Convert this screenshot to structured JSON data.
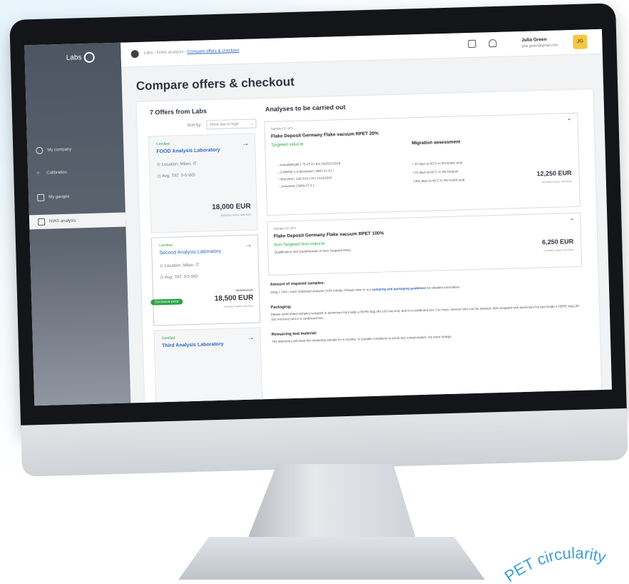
{
  "app": {
    "logo": "Labs"
  },
  "sidebar": {
    "items": [
      {
        "label": "My company",
        "active": false
      },
      {
        "label": "Calibration",
        "active": false
      },
      {
        "label": "My gauges",
        "active": false
      },
      {
        "label": "NIAS analysis",
        "active": true
      }
    ]
  },
  "topbar": {
    "breadcrumb": [
      "Labs",
      "NIAS analysis",
      "Compare offers & checkout"
    ],
    "breadcrumb_sep": "›",
    "user_name": "Julia Green",
    "user_email": "julia.green@gmail.com",
    "avatar_initials": "JG"
  },
  "page": {
    "title": "Compare offers & checkout"
  },
  "offers": {
    "heading": "7 Offers from Labs",
    "sort_label": "Sort by:",
    "sort_value": "Price low to high",
    "items": [
      {
        "badge": "Certified",
        "name": "FOOD Analysis Laboratory",
        "location": "Location: Milan, IT",
        "turnaround": "Avg. TAT: 3-5 WD",
        "price": "18,000 EUR",
        "fees": "Includes taxes and fees"
      },
      {
        "badge": "Certified",
        "name": "Second Analysis Laboratory",
        "location": "Location: Milan, IT",
        "turnaround": "Avg. TAT: 3-5 WD",
        "old_price": "20,000 EUR",
        "exclusive": "Exclusive price",
        "price": "18,500 EUR",
        "fees": "Includes taxes and fees"
      },
      {
        "badge": "Certified",
        "name": "Third Analysis Laboratory"
      }
    ]
  },
  "analyses": {
    "heading": "Analyses to be carried out",
    "cards": [
      {
        "ref": "Sample 01 ref'n",
        "title": "Flake Deposit Germany Flake vacuum RPET 20%",
        "subtitle": "Targeted indus'ie",
        "migration_title": "Migration assessment",
        "substances": [
          "Acetaldehyde  |  75-07-0  |  EU 10/2011/2018",
          "2-Methyl-1,3-dioxolane  |  3887-21-8  |  -",
          "Benzene  |  136-23-8  |  EU 1413/2020",
          "Limonene  |  5989-27-5  |  -"
        ],
        "migration": [
          "10 days at 40°C in 3% Acetic acid",
          "10 days at 60°C in 3% Ethanol",
          "365 days at 40°C in 3% Acetic acid"
        ],
        "price": "12,250 EUR",
        "fees": "Includes taxes and fees"
      },
      {
        "ref": "Sample 02 ref'n",
        "title": "Flake Deposit Germany Flake vacuum RPET 100%",
        "subtitle": "Non-Targeted Non-indus'ie",
        "description": "Qualification and Quantification of Non Targeted NIAS",
        "price": "6,250 EUR",
        "fees": "Includes taxes and fees"
      }
    ]
  },
  "info": {
    "samples_h": "Amount of required samples:",
    "samples_t": "200g + 10% / each individual analysis (10% inhale). Please refer to our",
    "samples_link": "sampling and packaging guidelines",
    "samples_t2": "for detailed information.",
    "packaging_h": "Packaging:",
    "packaging_t": "Please send sheet samples wrapped in aluminium foil inside a HDPE bag (40-100 microns) and in a cardboard box. For trays, several units can be stacked, then wrapped with aluminium foil and inside a HDPE bag (40-100 microns) and in a cardboard box.",
    "remaining_h": "Remaining test material:",
    "remaining_t": "The laboratory will keep the remaining sample for 6 months, in suitable conditions to avoid any contamination. No extra charge."
  },
  "stamp": {
    "text": "PET circularity"
  }
}
